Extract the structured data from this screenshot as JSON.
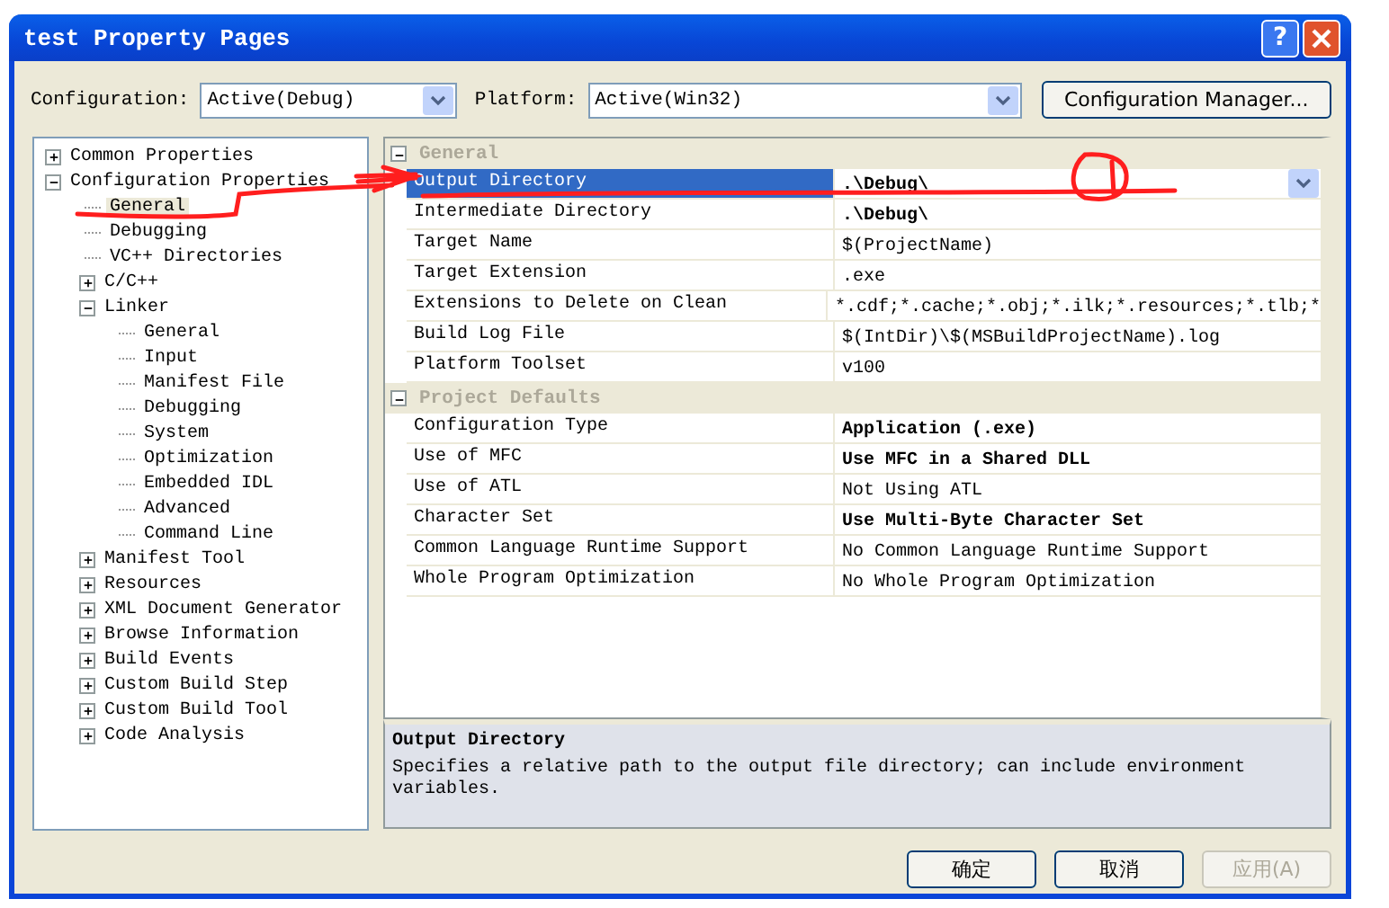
{
  "window": {
    "title": "test Property Pages",
    "help": "?"
  },
  "toolbar": {
    "configuration_label": "Configuration:",
    "configuration": "Active(Debug)",
    "platform_label": "Platform:",
    "platform": "Active(Win32)",
    "manager_button": "Configuration Manager..."
  },
  "tree": [
    {
      "label": "Common Properties",
      "expanded": false,
      "selected": false
    },
    {
      "label": "Configuration Properties",
      "expanded": true,
      "selected": false,
      "children": [
        {
          "label": "General",
          "selected": true
        },
        {
          "label": "Debugging",
          "selected": false
        },
        {
          "label": "VC++ Directories",
          "selected": false
        },
        {
          "label": "C/C++",
          "expanded": false,
          "selected": false
        },
        {
          "label": "Linker",
          "expanded": true,
          "selected": false,
          "children": [
            {
              "label": "General",
              "selected": false
            },
            {
              "label": "Input",
              "selected": false
            },
            {
              "label": "Manifest File",
              "selected": false
            },
            {
              "label": "Debugging",
              "selected": false
            },
            {
              "label": "System",
              "selected": false
            },
            {
              "label": "Optimization",
              "selected": false
            },
            {
              "label": "Embedded IDL",
              "selected": false
            },
            {
              "label": "Advanced",
              "selected": false
            },
            {
              "label": "Command Line",
              "selected": false
            }
          ]
        },
        {
          "label": "Manifest Tool",
          "expanded": false,
          "selected": false
        },
        {
          "label": "Resources",
          "expanded": false,
          "selected": false
        },
        {
          "label": "XML Document Generator",
          "expanded": false,
          "selected": false
        },
        {
          "label": "Browse Information",
          "expanded": false,
          "selected": false
        },
        {
          "label": "Build Events",
          "expanded": false,
          "selected": false
        },
        {
          "label": "Custom Build Step",
          "expanded": false,
          "selected": false
        },
        {
          "label": "Custom Build Tool",
          "expanded": false,
          "selected": false
        },
        {
          "label": "Code Analysis",
          "expanded": false,
          "selected": false
        }
      ]
    }
  ],
  "grid": [
    {
      "category": "General",
      "expanded": true,
      "rows": [
        {
          "name": "Output Directory",
          "value": ".\\Debug\\",
          "bold": true,
          "selected": true
        },
        {
          "name": "Intermediate Directory",
          "value": ".\\Debug\\",
          "bold": true,
          "selected": false
        },
        {
          "name": "Target Name",
          "value": "$(ProjectName)",
          "bold": false,
          "selected": false
        },
        {
          "name": "Target Extension",
          "value": ".exe",
          "bold": false,
          "selected": false
        },
        {
          "name": "Extensions to Delete on Clean",
          "value": "*.cdf;*.cache;*.obj;*.ilk;*.resources;*.tlb;*",
          "bold": false,
          "selected": false
        },
        {
          "name": "Build Log File",
          "value": "$(IntDir)\\$(MSBuildProjectName).log",
          "bold": false,
          "selected": false
        },
        {
          "name": "Platform Toolset",
          "value": "v100",
          "bold": false,
          "selected": false
        }
      ]
    },
    {
      "category": "Project Defaults",
      "expanded": true,
      "rows": [
        {
          "name": "Configuration Type",
          "value": "Application (.exe)",
          "bold": true,
          "selected": false
        },
        {
          "name": "Use of MFC",
          "value": "Use MFC in a Shared DLL",
          "bold": true,
          "selected": false
        },
        {
          "name": "Use of ATL",
          "value": "Not Using ATL",
          "bold": false,
          "selected": false
        },
        {
          "name": "Character Set",
          "value": "Use Multi-Byte Character Set",
          "bold": true,
          "selected": false
        },
        {
          "name": "Common Language Runtime Support",
          "value": "No Common Language Runtime Support",
          "bold": false,
          "selected": false
        },
        {
          "name": "Whole Program Optimization",
          "value": "No Whole Program Optimization",
          "bold": false,
          "selected": false
        }
      ]
    }
  ],
  "description": {
    "title": "Output Directory",
    "text": "Specifies a relative path to the output file directory; can include environment variables."
  },
  "buttons": [
    {
      "label": "确定",
      "disabled": false
    },
    {
      "label": "取消",
      "disabled": false
    },
    {
      "label": "应用(A)",
      "disabled": true
    }
  ]
}
